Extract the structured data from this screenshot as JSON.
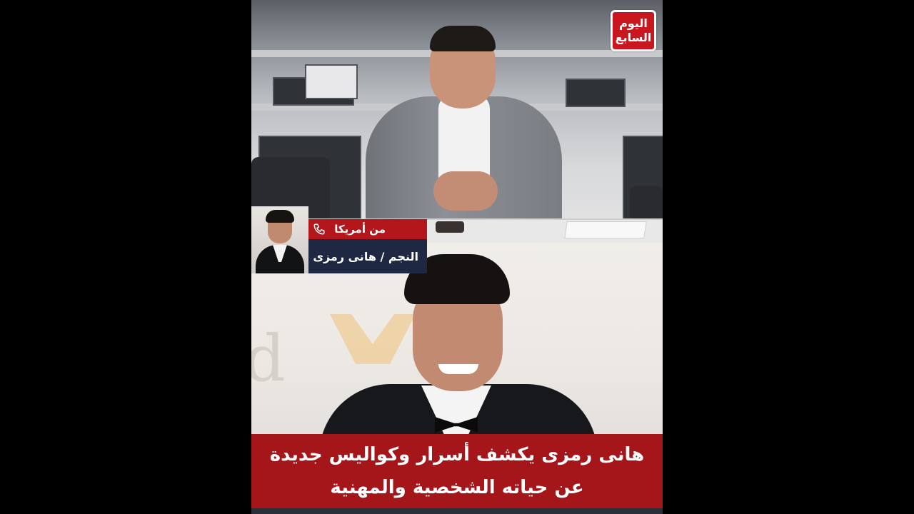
{
  "logo": {
    "line1": "اليوم",
    "line2": "السابع"
  },
  "caller": {
    "from_label": "من أمريكا",
    "guest_name": "النجم / هانى رمزى",
    "phone_icon": "phone-icon"
  },
  "headline": {
    "line1": "هانى رمزى يكشف أسرار وكواليس جديدة",
    "line2": "عن حياته الشخصية والمهنية"
  },
  "colors": {
    "brand_red": "#b3171c",
    "navy": "#1e2842",
    "headline_red": "#a5161a"
  }
}
